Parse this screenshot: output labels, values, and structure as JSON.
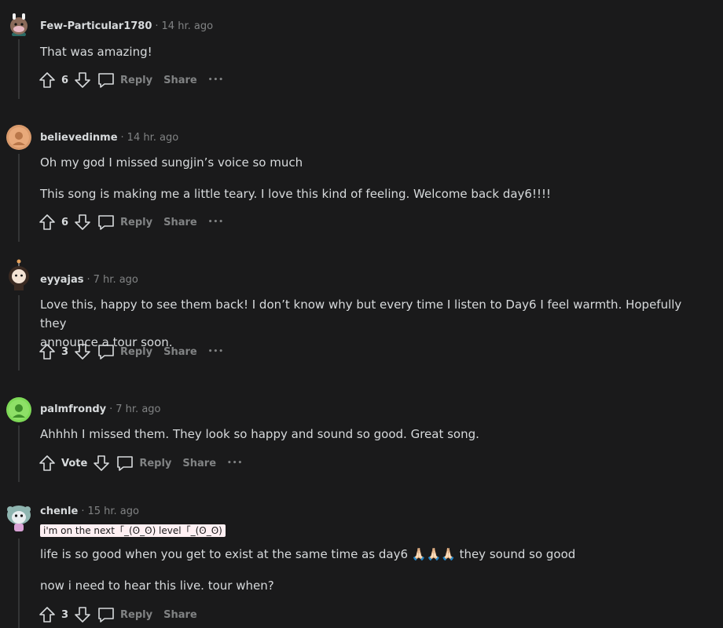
{
  "comments": [
    {
      "author": "Few-Particular1780",
      "time": "14 hr. ago",
      "paragraphs": [
        "That was amazing!"
      ],
      "score": "6",
      "reply_label": "Reply",
      "share_label": "Share"
    },
    {
      "author": "believedinme",
      "time": "14 hr. ago",
      "paragraphs": [
        "Oh my god I missed sungjin’s voice so much",
        "This song is making me a little teary. I love this kind of feeling. Welcome back day6!!!!"
      ],
      "score": "6",
      "reply_label": "Reply",
      "share_label": "Share"
    },
    {
      "author": "eyyajas",
      "time": "7 hr. ago",
      "paragraphs": [
        "Love this, happy to see them back! I don’t know why but every time I listen to Day6 I feel warmth. Hopefully they",
        "announce a tour soon."
      ],
      "score": "3",
      "reply_label": "Reply",
      "share_label": "Share"
    },
    {
      "author": "palmfrondy",
      "time": "7 hr. ago",
      "paragraphs": [
        "Ahhhh I missed them. They look so happy and sound so good. Great song."
      ],
      "score": "Vote",
      "reply_label": "Reply",
      "share_label": "Share"
    },
    {
      "author": "chenle",
      "time": "15 hr. ago",
      "flair": "i'm on the next「_(ʘ_ʘ) level「_(ʘ_ʘ)",
      "paragraphs": [
        "life is so good when you get to exist at the same time as day6 🙏🏻🙏🏻🙏🏻 they sound so good",
        "now i need to hear this live. tour when?"
      ],
      "score": "3",
      "reply_label": "Reply",
      "share_label": "Share"
    }
  ],
  "separator": "·",
  "more_glyph": "•••",
  "colors": {
    "background": "#1a1a1b",
    "text": "#d7dadc",
    "meta": "#818384",
    "thread_line": "#343536",
    "flair_bg": "#fff0f3"
  },
  "icons": [
    "upvote-icon",
    "downvote-icon",
    "comment-bubble-icon",
    "more-options-icon"
  ]
}
